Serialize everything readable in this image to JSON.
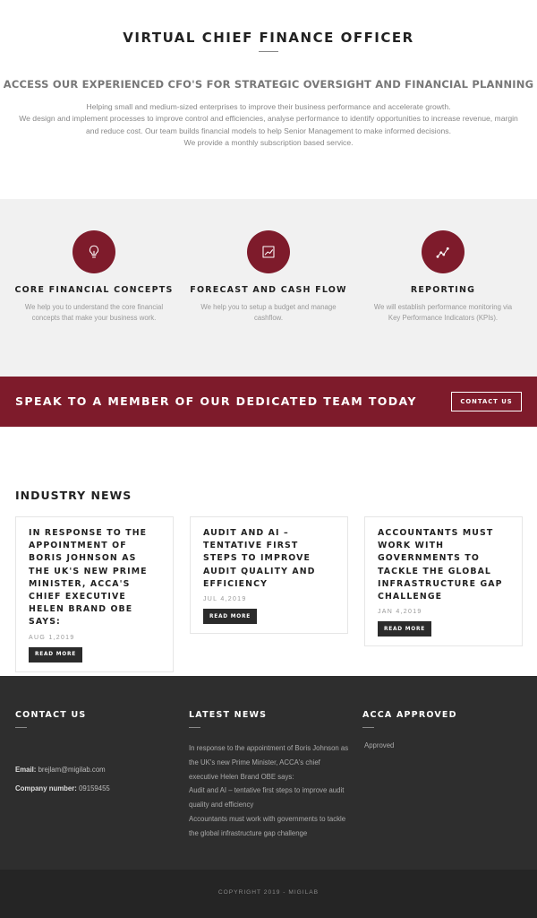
{
  "intro": {
    "title": "VIRTUAL CHIEF FINANCE OFFICER",
    "subtitle": "ACCESS OUR EXPERIENCED CFO'S FOR STRATEGIC OVERSIGHT AND FINANCIAL PLANNING",
    "lines": [
      "Helping small and medium-sized enterprises to improve their business performance and accelerate growth.",
      "We design and implement processes to improve control and efficiencies, analyse performance to identify opportunities to increase revenue, margin and reduce cost. Our team builds financial models to help Senior Management to make informed decisions.",
      "We provide a monthly subscription based service."
    ]
  },
  "services": [
    {
      "icon": "lightbulb-icon",
      "title": "CORE FINANCIAL CONCEPTS",
      "text": "We help you to understand the core financial concepts that make your business work."
    },
    {
      "icon": "chart-icon",
      "title": "FORECAST AND CASH FLOW",
      "text": "We help you to setup a budget and manage cashflow."
    },
    {
      "icon": "trend-line-icon",
      "title": "REPORTING",
      "text": "We will establish performance monitoring via Key Performance Indicators (KPIs)."
    }
  ],
  "cta": {
    "text": "SPEAK TO A MEMBER OF OUR DEDICATED TEAM TODAY",
    "button": "CONTACT US"
  },
  "news": {
    "heading": "INDUSTRY NEWS",
    "read_more": "READ MORE",
    "items": [
      {
        "title": "IN RESPONSE TO THE APPOINTMENT OF BORIS JOHNSON AS THE UK'S NEW PRIME MINISTER, ACCA'S CHIEF EXECUTIVE HELEN BRAND OBE SAYS:",
        "date": "AUG 1,2019"
      },
      {
        "title": "AUDIT AND AI – TENTATIVE FIRST STEPS TO IMPROVE AUDIT QUALITY AND EFFICIENCY",
        "date": "JUL 4,2019"
      },
      {
        "title": "ACCOUNTANTS MUST WORK WITH GOVERNMENTS TO TACKLE THE GLOBAL INFRASTRUCTURE GAP CHALLENGE",
        "date": "JAN 4,2019"
      }
    ]
  },
  "footer": {
    "contact": {
      "heading": "CONTACT US",
      "email_label": "Email:",
      "email": "brejlam@migilab.com",
      "company_label": "Company number:",
      "company": "09159455"
    },
    "latest": {
      "heading": "LATEST NEWS",
      "items": [
        "In response to the appointment of Boris Johnson as the UK's new Prime Minister, ACCA's chief executive Helen Brand OBE says:",
        "Audit and AI – tentative first steps to improve audit quality and efficiency",
        "Accountants must work with governments to tackle the global infrastructure gap challenge"
      ]
    },
    "acca": {
      "heading": "ACCA APPROVED",
      "text": "Approved"
    },
    "copyright": "COPYRIGHT 2019 - MIGILAB"
  },
  "colors": {
    "accent": "#7e1b2b",
    "footer_bg": "#2e2e2e",
    "bottom_bar_bg": "#252525",
    "services_bg": "#f1f1f1"
  }
}
